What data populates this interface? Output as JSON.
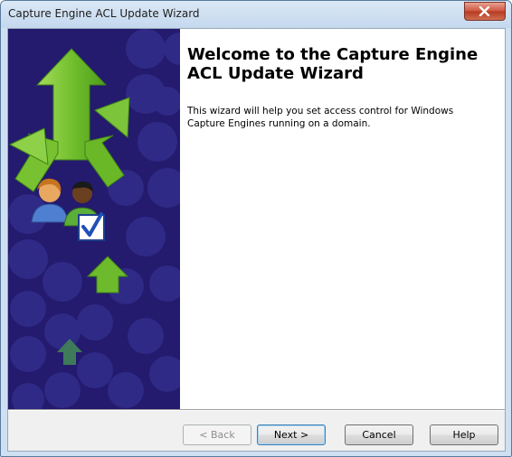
{
  "window": {
    "title": "Capture Engine ACL Update Wizard"
  },
  "page": {
    "heading": "Welcome to the Capture Engine ACL Update Wizard",
    "description": "This wizard will help you set access control for Windows Capture Engines running on a domain."
  },
  "buttons": {
    "back": "< Back",
    "next": "Next >",
    "cancel": "Cancel",
    "help": "Help"
  },
  "icons": {
    "close": "close-icon",
    "banner_arrows": "arrows-icon",
    "users": "users-check-icon"
  },
  "colors": {
    "banner_background": "#241a6e",
    "arrow_green": "#7cc43a",
    "default_button_border": "#3c7fb1"
  }
}
